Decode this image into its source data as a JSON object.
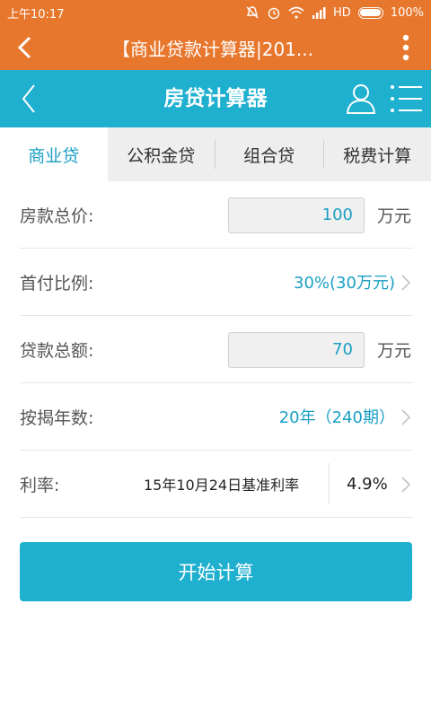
{
  "status_bar": {
    "time": "上午10:17",
    "network": "HD",
    "battery": "100%",
    "battery_level": 1.0
  },
  "browser": {
    "title": "【商业贷款计算器|201..."
  },
  "header": {
    "title": "房贷计算器"
  },
  "tabs": [
    {
      "label": "商业贷",
      "active": true
    },
    {
      "label": "公积金贷",
      "active": false
    },
    {
      "label": "组合贷",
      "active": false
    },
    {
      "label": "税费计算",
      "active": false
    }
  ],
  "form": {
    "total_price": {
      "label": "房款总价:",
      "value": "100",
      "unit": "万元"
    },
    "down_payment": {
      "label": "首付比例:",
      "value": "30%(30万元)"
    },
    "loan_amount": {
      "label": "贷款总额:",
      "value": "70",
      "unit": "万元"
    },
    "term": {
      "label": "按揭年数:",
      "value": "20年（240期）"
    },
    "rate": {
      "label": "利率:",
      "description": "15年10月24日基准利率",
      "value": "4.9%"
    }
  },
  "actions": {
    "calculate": "开始计算"
  },
  "colors": {
    "status_bar": "#e8772e",
    "header": "#1fb0cf",
    "accent_text": "#1a9fc4"
  }
}
